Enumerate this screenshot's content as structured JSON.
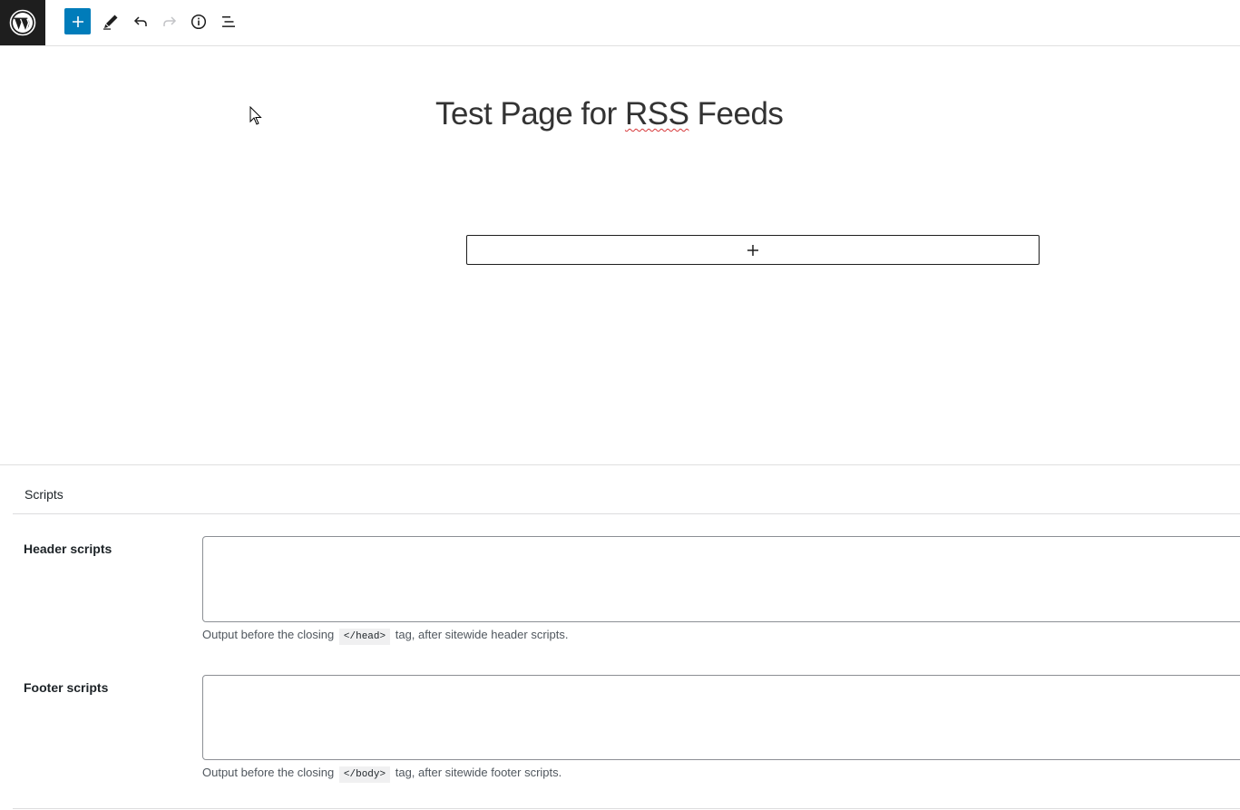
{
  "toolbar": {
    "logo_icon": "wordpress-logo-icon",
    "inserter_icon": "plus-icon",
    "edit_icon": "pencil-icon",
    "undo_icon": "undo-icon",
    "redo_icon": "redo-icon",
    "info_icon": "info-icon",
    "outline_icon": "list-view-icon",
    "accent_color": "#007cba"
  },
  "editor": {
    "title_part1": "Test Page for ",
    "title_misspelled": "RSS",
    "title_part2": " Feeds",
    "appender_symbol": "+"
  },
  "metabox": {
    "title": "Scripts",
    "header_label": "Header scripts",
    "header_value": "",
    "header_desc_before": "Output before the closing",
    "header_desc_code": "</head>",
    "header_desc_after": "tag, after sitewide header scripts.",
    "footer_label": "Footer scripts",
    "footer_value": "",
    "footer_desc_before": "Output before the closing",
    "footer_desc_code": "</body>",
    "footer_desc_after": "tag, after sitewide footer scripts."
  }
}
